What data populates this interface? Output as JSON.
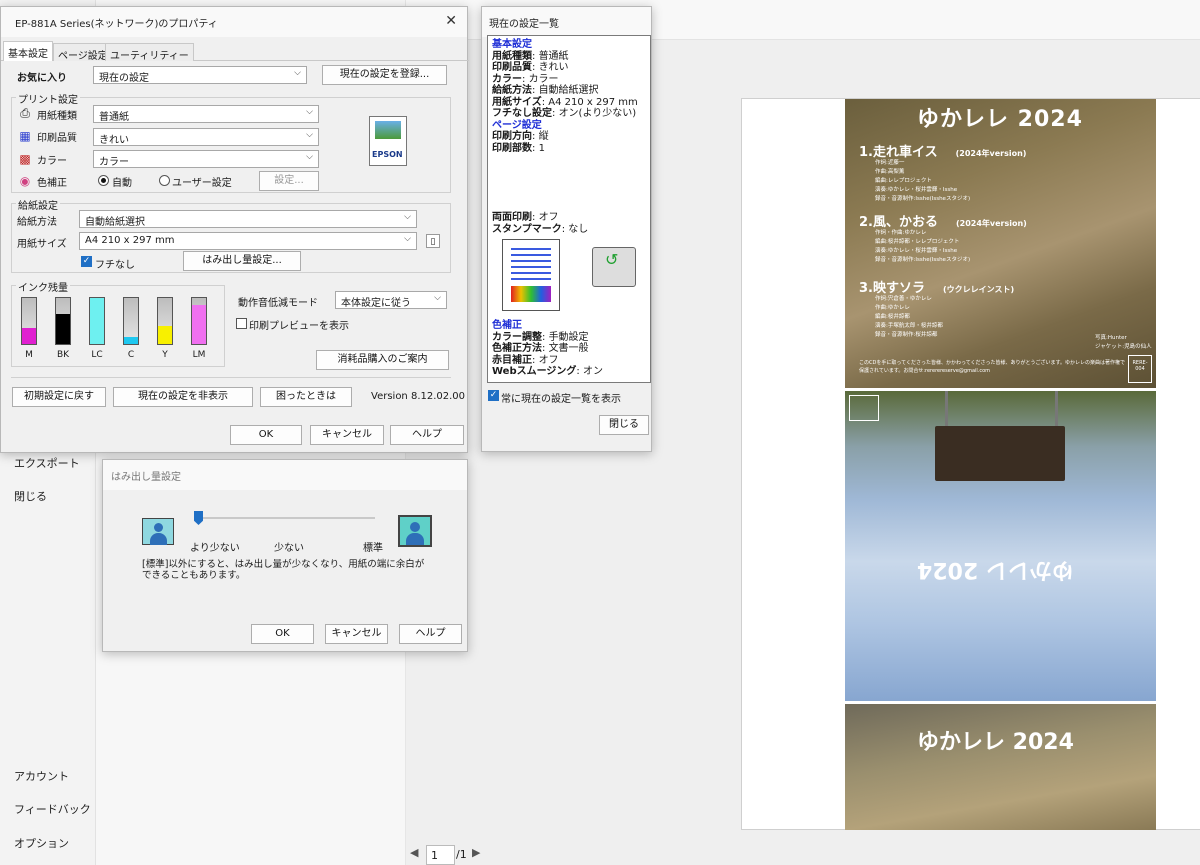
{
  "nav": {
    "export": "エクスポート",
    "close": "閉じる",
    "account": "アカウント",
    "feedback": "フィードバック",
    "options": "オプション"
  },
  "pager": {
    "prev": "◀",
    "current": "1",
    "total": "/1",
    "next": "▶"
  },
  "props": {
    "title": "EP-881A Series(ネットワーク)のプロパティ",
    "tabs": [
      "基本設定",
      "ページ設定",
      "ユーティリティー"
    ],
    "favorites_label": "お気に入り",
    "favorites_value": "現在の設定",
    "register_button": "現在の設定を登録...",
    "print_group": "プリント設定",
    "paper_type_label": "用紙種類",
    "paper_type_value": "普通紙",
    "quality_label": "印刷品質",
    "quality_value": "きれい",
    "color_label": "カラー",
    "color_value": "カラー",
    "correction_label": "色補正",
    "correction_auto": "自動",
    "correction_user": "ユーザー設定",
    "settings_button": "設定...",
    "feed_group": "給紙設定",
    "source_label": "給紙方法",
    "source_value": "自動給紙選択",
    "size_label": "用紙サイズ",
    "size_value": "A4 210 x 297 mm",
    "borderless": "フチなし",
    "overflow_button": "はみ出し量設定...",
    "ink_group": "インク残量",
    "inks": [
      {
        "name": "M",
        "level": 0.35,
        "color": "#e020d0"
      },
      {
        "name": "BK",
        "level": 0.65,
        "color": "#000000"
      },
      {
        "name": "LC",
        "level": 1.0,
        "color": "#6ef0f0"
      },
      {
        "name": "C",
        "level": 0.15,
        "color": "#1ec8f0"
      },
      {
        "name": "Y",
        "level": 0.4,
        "color": "#f8f000"
      },
      {
        "name": "LM",
        "level": 0.85,
        "color": "#f070f0"
      }
    ],
    "quiet_label": "動作音低減モード",
    "quiet_value": "本体設定に従う",
    "preview_check": "印刷プレビューを表示",
    "supplies_button": "消耗品購入のご案内",
    "reset_button": "初期設定に戻す",
    "hide_button": "現在の設定を非表示",
    "help_trouble_button": "困ったときは",
    "version": "Version 8.12.02.00",
    "ok": "OK",
    "cancel": "キャンセル",
    "help": "ヘルプ",
    "brand": "EPSON"
  },
  "summary": {
    "title": "現在の設定一覧",
    "sec_basic": "基本設定",
    "rows_basic": [
      {
        "k": "用紙種類",
        "v": "普通紙"
      },
      {
        "k": "印刷品質",
        "v": "きれい"
      },
      {
        "k": "カラー",
        "v": "カラー"
      },
      {
        "k": "給紙方法",
        "v": "自動給紙選択"
      },
      {
        "k": "用紙サイズ",
        "v": "A4 210 x 297 mm"
      },
      {
        "k": "フチなし設定",
        "v": "オン(より少ない)"
      }
    ],
    "sec_page": "ページ設定",
    "rows_page": [
      {
        "k": "印刷方向",
        "v": "縦"
      },
      {
        "k": "印刷部数",
        "v": "1"
      }
    ],
    "rows_extra": [
      {
        "k": "両面印刷",
        "v": "オフ"
      },
      {
        "k": "スタンプマーク",
        "v": "なし"
      }
    ],
    "sec_color": "色補正",
    "rows_color": [
      {
        "k": "カラー調整",
        "v": "手動設定"
      },
      {
        "k": "色補正方法",
        "v": "文書一般"
      },
      {
        "k": "赤目補正",
        "v": "オフ"
      },
      {
        "k": "Webスムージング",
        "v": "オン"
      }
    ],
    "always_show": "常に現在の設定一覧を表示",
    "close": "閉じる"
  },
  "overflow": {
    "title": "はみ出し量設定",
    "level_less": "より少ない",
    "level_few": "少ない",
    "level_std": "標準",
    "note": "[標準]以外にすると、はみ出し量が少なくなり、用紙の端に余白ができることもあります。",
    "ok": "OK",
    "cancel": "キャンセル",
    "help": "ヘルプ"
  },
  "cd": {
    "title": "ゆかレレ 2024",
    "tracks": [
      {
        "name": "1.走れ車イス",
        "ver": "(2024年version)",
        "credits": [
          "作詞:近藤一",
          "作曲:高梨薫",
          "編曲:レレプロジェクト",
          "演奏:ゆかレレ・桜井雲輝・Isshe",
          "録音・音源制作:Isshe(Issheスタジオ)"
        ]
      },
      {
        "name": "2.風、かおる",
        "ver": "(2024年version)",
        "credits": [
          "作詞・作曲:ゆかレレ",
          "編曲:桜井諒都・レレプロジェクト",
          "演奏:ゆかレレ・桜井雲輝・Isshe",
          "録音・音源制作:Isshe(Issheスタジオ)"
        ]
      },
      {
        "name": "3.映すソラ",
        "ver": "(ウクレレインスト)",
        "credits": [
          "作詞:宍倉善・ゆかレレ",
          "作曲:ゆかレレ",
          "編曲:桜井諒都",
          "演奏:手塚航太郎・桜井諒都",
          "録音・音源制作:桜井諒都"
        ]
      }
    ],
    "photo": "写真:Hunter",
    "jacket": "ジャケット:児島の仙人",
    "note": "このCDを手に取ってくださった皆様、かかわってくださった皆様、ありがとうございます。ゆかレレの楽曲は著作権で保護されています。お問合せ:rererereserve@gmail.com",
    "code": "RERE-004",
    "mirror_title": "ゆかレレ 2024"
  }
}
